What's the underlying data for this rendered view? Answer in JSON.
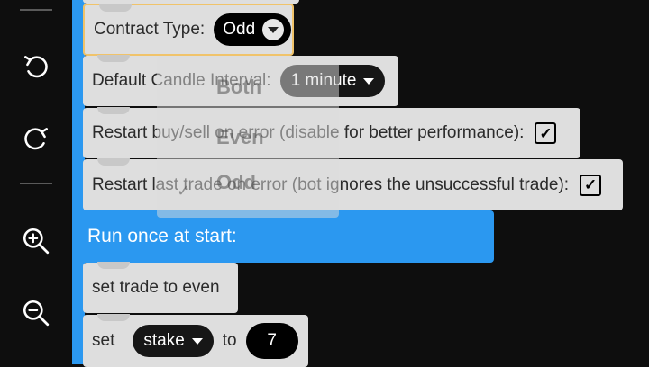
{
  "toolbar": {
    "undo_icon": "undo-icon",
    "redo_icon": "redo-icon",
    "zoom_in_icon": "zoom-in-icon",
    "zoom_out_icon": "zoom-out-icon"
  },
  "blocks": {
    "contract_type": {
      "label": "Contract Type:",
      "value": "Odd"
    },
    "candle_interval": {
      "label": "Default Candle Interval:",
      "value": "1 minute"
    },
    "restart_buysell": {
      "label": "Restart buy/sell on error (disable for better performance):",
      "checked": "✓"
    },
    "restart_last_trade": {
      "label": "Restart last trade on error (bot ignores the unsuccessful trade):",
      "checked": "✓"
    },
    "run_once": {
      "label": "Run once at start:"
    },
    "set_trade": {
      "label": "set trade to even"
    },
    "set_stake": {
      "set_label": "set",
      "variable": "stake",
      "to_label": "to",
      "value": "7"
    }
  },
  "dropdown": {
    "options": [
      "Both",
      "Even",
      "Odd"
    ],
    "selected": "Odd"
  },
  "colors": {
    "accent_blue": "#2b98f0",
    "block_bg": "#dedede",
    "selection_outline": "#f0c36a",
    "background": "#0e0e0e"
  }
}
